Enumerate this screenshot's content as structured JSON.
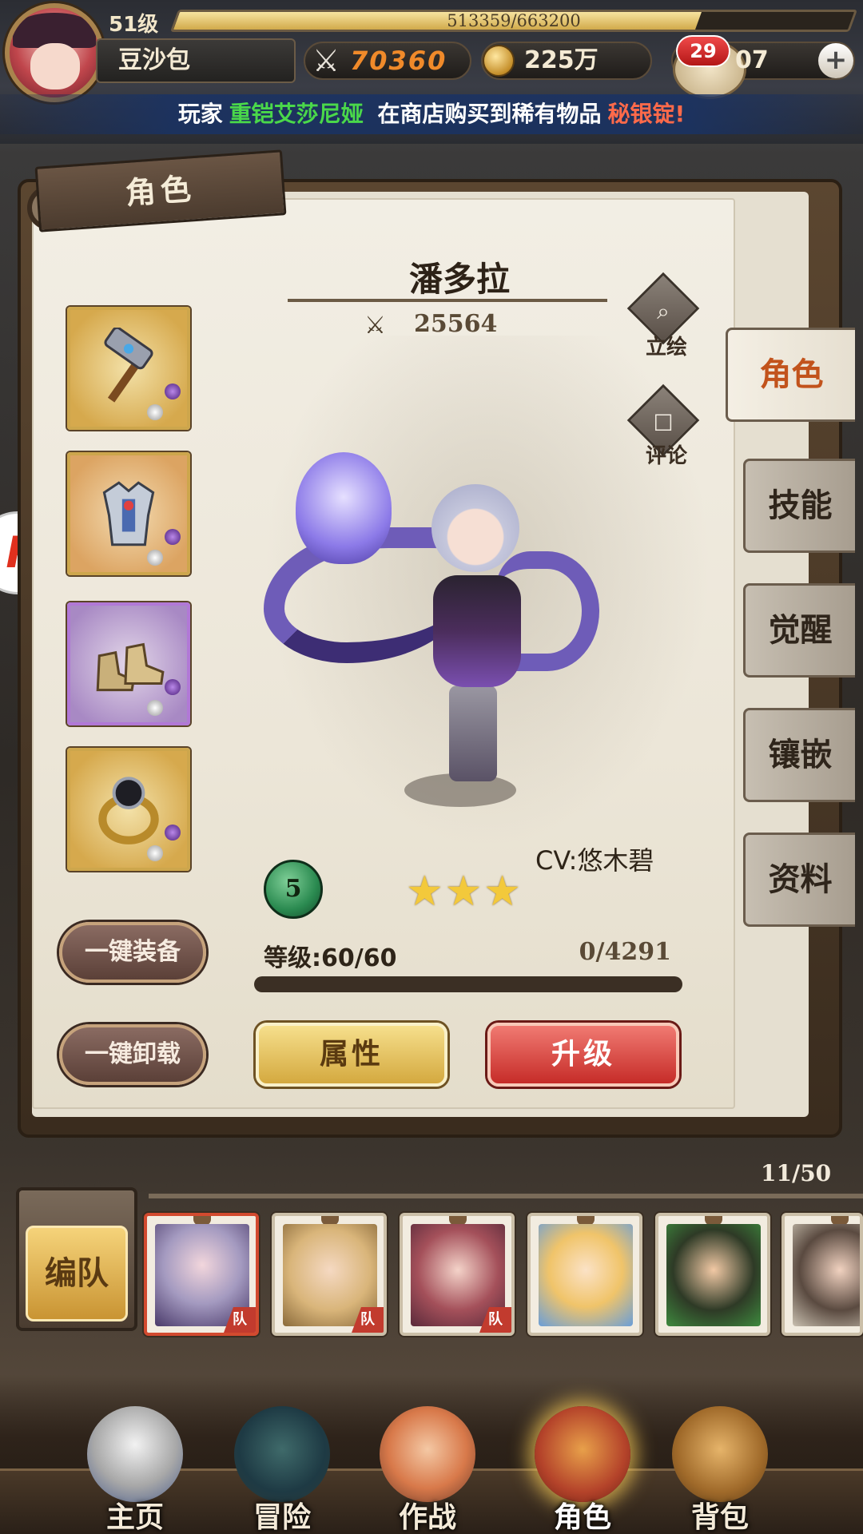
{
  "header": {
    "level": "51级",
    "xp_text": "513359/663200",
    "xp_progress": 0.774,
    "player_name": "豆沙包",
    "combat_power": "70360",
    "gold": "225万",
    "gems": "07",
    "chat_badge": "29",
    "plus": "+"
  },
  "banner": {
    "prefix": "玩家",
    "player": "重铠艾莎尼娅",
    "middle": "在商店购买到稀有物品",
    "item": "秘银锭!",
    "colors": {
      "player": "#4ad84a",
      "item": "#ff6a4a"
    }
  },
  "panel": {
    "tag": "角色",
    "character_name": "潘多拉",
    "character_power": "25564",
    "portrait_label": "立绘",
    "review_label": "评论",
    "cv": "CV:悠木碧",
    "rank": "5",
    "stars": "★★★",
    "star_count": 3,
    "level_text": "等级:60/60",
    "exp_text": "0/4291",
    "exp_progress": 0,
    "equip_all": "一键装备",
    "unequip_all": "一键卸载",
    "attributes": "属性",
    "upgrade": "升级"
  },
  "equipment": [
    {
      "slot": "weapon",
      "icon": "hammer-icon"
    },
    {
      "slot": "armor",
      "icon": "armor-icon"
    },
    {
      "slot": "boots",
      "icon": "boots-icon"
    },
    {
      "slot": "ring",
      "icon": "ring-icon"
    }
  ],
  "side_tabs": [
    "角色",
    "技能",
    "觉醒",
    "镶嵌",
    "资料"
  ],
  "roster": {
    "count": "11/50",
    "team_button": "编队",
    "team_tag": "队"
  },
  "nav": [
    "主页",
    "冒险",
    "作战",
    "角色",
    "背包"
  ],
  "colors": {
    "accent_red": "#c62c28",
    "accent_gold": "#d4a93f",
    "active_tab_text": "#c2531c"
  }
}
